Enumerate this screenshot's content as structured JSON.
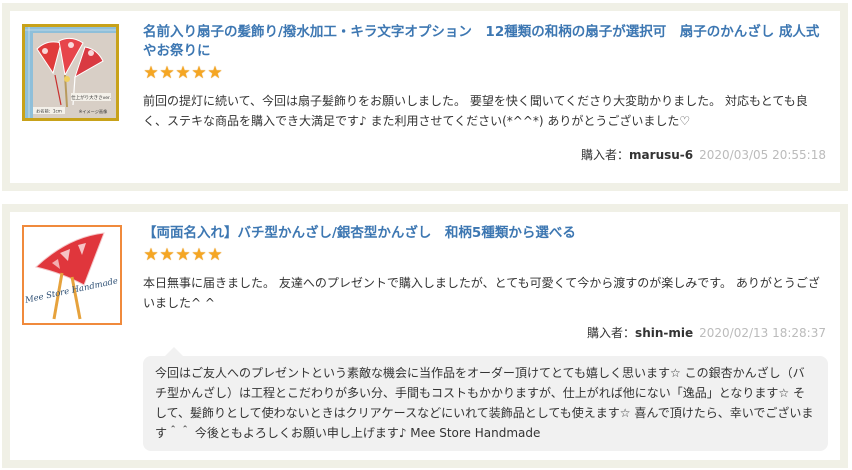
{
  "reviews": [
    {
      "product_title": "名前入り扇子の髪飾り/撥水加工・キラ文字オプション　12種類の和柄の扇子が選択可　扇子のかんざし 成人式やお祭りに",
      "rating": 5,
      "text": "前回の提灯に続いて、今回は扇子髪飾りをお願いしました。 要望を快く聞いてくださり大変助かりました。 対応もとても良く、ステキな商品を購入でき大満足です♪ また利用させてください(*^^*) ありがとうございました♡",
      "buyer_label": "購入者：",
      "buyer_name": "marusu-6",
      "date": "2020/03/05 20:55:18",
      "thumb_text": {
        "note": "仕上がり大きさver.",
        "size": "お名前：1cm",
        "image": "※イメージ画像"
      }
    },
    {
      "product_title": "【両面名入れ】バチ型かんざし/銀杏型かんざし　和柄5種類から選べる",
      "rating": 5,
      "text": "本日無事に届きました。 友達へのプレゼントで購入しましたが、とても可愛くて今から渡すのが楽しみです。 ありがとうございました^ ^",
      "buyer_label": "購入者：",
      "buyer_name": "shin-mie",
      "date": "2020/02/13 18:28:37",
      "thumb_text": {
        "watermark": "Mee Store Handmade"
      },
      "reply": "今回はご友人へのプレゼントという素敵な機会に当作品をオーダー頂けてとても嬉しく思います☆ この銀杏かんざし（バチ型かんざし）は工程とこだわりが多い分、手間もコストもかかりますが、仕上がれば他にない「逸品」となります☆ そして、髪飾りとして使わないときはクリアケースなどにいれて装飾品としても使えます☆ 喜んで頂けたら、幸いでございます＾＾ 今後ともよろしくお願い申し上げます♪ Mee Store Handmade"
    }
  ],
  "colors": {
    "title_link": "#3d77b2",
    "star": "#f5a623",
    "card_border": "#f0f0e6",
    "reply_bg": "#f1f1f1",
    "date": "#bbbbbb"
  },
  "icons": [
    "star-icon"
  ]
}
